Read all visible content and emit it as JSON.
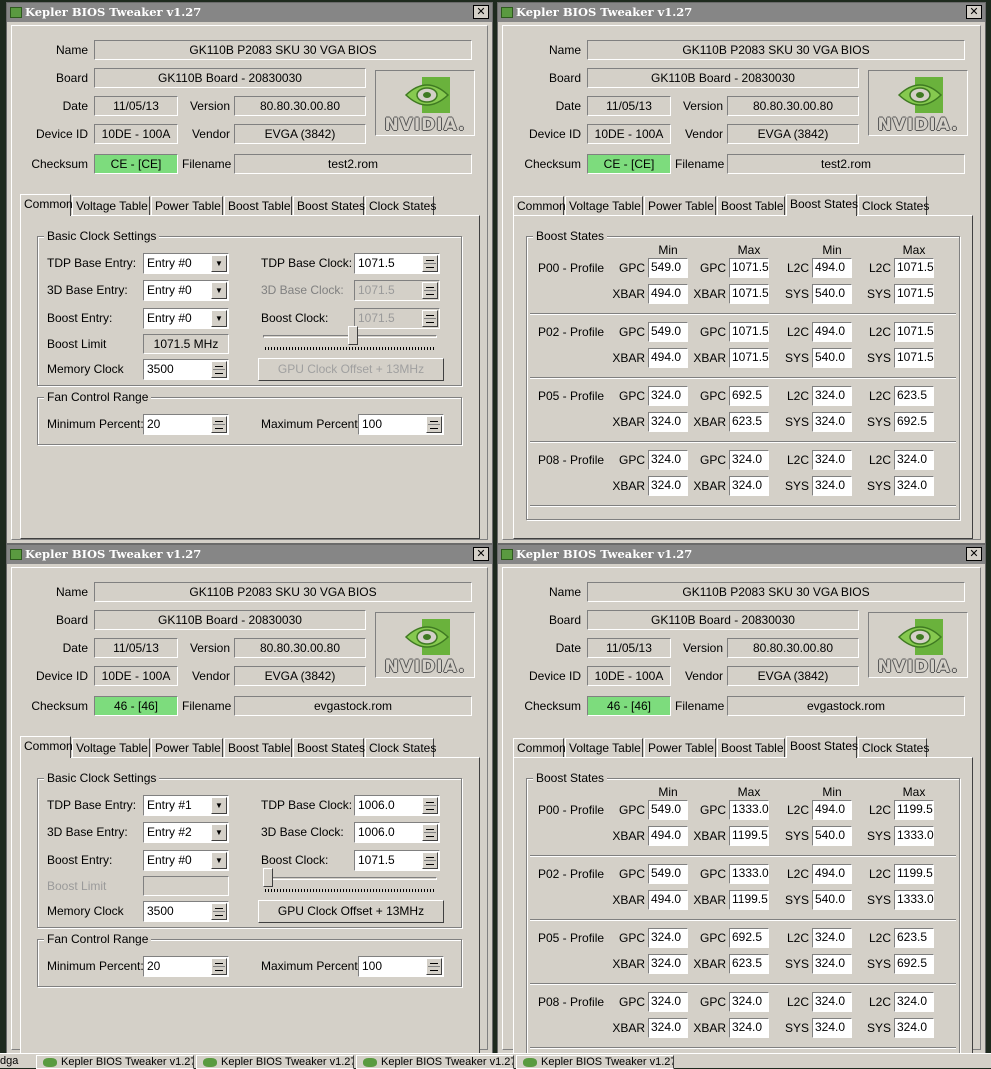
{
  "app": {
    "title": "Kepler BIOS Tweaker v1.27",
    "close_glyph": "✕",
    "logo_text": "NVIDIA."
  },
  "labels": {
    "name": "Name",
    "board": "Board",
    "date": "Date",
    "version": "Version",
    "device_id": "Device ID",
    "vendor": "Vendor",
    "checksum": "Checksum",
    "filename": "Filename"
  },
  "tabs": [
    "Common",
    "Voltage Table",
    "Power Table",
    "Boost Table",
    "Boost States",
    "Clock States"
  ],
  "common_labels": {
    "basic_clock_settings": "Basic Clock Settings",
    "tdp_base_entry": "TDP Base Entry:",
    "base3d_entry": "3D Base Entry:",
    "boost_entry": "Boost Entry:",
    "boost_limit": "Boost Limit",
    "memory_clock": "Memory Clock",
    "tdp_base_clock": "TDP Base Clock:",
    "base3d_clock": "3D Base Clock:",
    "boost_clock": "Boost Clock:",
    "gpu_offset_button": "GPU Clock Offset + 13MHz",
    "fan_control_range": "Fan Control Range",
    "min_percent": "Minimum Percent:",
    "max_percent": "Maximum Percent:"
  },
  "boost_labels": {
    "group": "Boost States",
    "min": "Min",
    "max": "Max",
    "gpc": "GPC",
    "xbar": "XBAR",
    "l2c": "L2C",
    "sys": "SYS"
  },
  "windows": {
    "tl": {
      "name": "GK110B P2083 SKU 30 VGA BIOS",
      "board": "GK110B Board - 20830030",
      "date": "11/05/13",
      "version": "80.80.30.00.80",
      "device_id": "10DE - 100A",
      "vendor": "EVGA (3842)",
      "checksum": "CE - [CE]",
      "filename": "test2.rom",
      "tdp_base_entry": "Entry #0",
      "base3d_entry": "Entry #0",
      "boost_entry": "Entry #0",
      "tdp_base_clock": "1071.5",
      "base3d_clock": "1071.5",
      "boost_clock": "1071.5",
      "boost_limit": "1071.5 MHz",
      "memory_clock": "3500",
      "min_percent": "20",
      "max_percent": "100"
    },
    "tr": {
      "name": "GK110B P2083 SKU 30 VGA BIOS",
      "board": "GK110B Board - 20830030",
      "date": "11/05/13",
      "version": "80.80.30.00.80",
      "device_id": "10DE - 100A",
      "vendor": "EVGA (3842)",
      "checksum": "CE - [CE]",
      "filename": "test2.rom",
      "profiles": [
        {
          "name": "P00 - Profile",
          "gpc_min": "549.0",
          "gpc_max": "1071.5",
          "l2c_min": "494.0",
          "l2c_max": "1071.5",
          "xbar_min": "494.0",
          "xbar_max": "1071.5",
          "sys_min": "540.0",
          "sys_max": "1071.5"
        },
        {
          "name": "P02 - Profile",
          "gpc_min": "549.0",
          "gpc_max": "1071.5",
          "l2c_min": "494.0",
          "l2c_max": "1071.5",
          "xbar_min": "494.0",
          "xbar_max": "1071.5",
          "sys_min": "540.0",
          "sys_max": "1071.5"
        },
        {
          "name": "P05 - Profile",
          "gpc_min": "324.0",
          "gpc_max": "692.5",
          "l2c_min": "324.0",
          "l2c_max": "623.5",
          "xbar_min": "324.0",
          "xbar_max": "623.5",
          "sys_min": "324.0",
          "sys_max": "692.5"
        },
        {
          "name": "P08 - Profile",
          "gpc_min": "324.0",
          "gpc_max": "324.0",
          "l2c_min": "324.0",
          "l2c_max": "324.0",
          "xbar_min": "324.0",
          "xbar_max": "324.0",
          "sys_min": "324.0",
          "sys_max": "324.0"
        }
      ]
    },
    "bl": {
      "name": "GK110B P2083 SKU 30 VGA BIOS",
      "board": "GK110B Board - 20830030",
      "date": "11/05/13",
      "version": "80.80.30.00.80",
      "device_id": "10DE - 100A",
      "vendor": "EVGA (3842)",
      "checksum": "46 - [46]",
      "filename": "evgastock.rom",
      "tdp_base_entry": "Entry #1",
      "base3d_entry": "Entry #2",
      "boost_entry": "Entry #0",
      "tdp_base_clock": "1006.0",
      "base3d_clock": "1006.0",
      "boost_clock": "1071.5",
      "boost_limit": "",
      "memory_clock": "3500",
      "min_percent": "20",
      "max_percent": "100"
    },
    "br": {
      "name": "GK110B P2083 SKU 30 VGA BIOS",
      "board": "GK110B Board - 20830030",
      "date": "11/05/13",
      "version": "80.80.30.00.80",
      "device_id": "10DE - 100A",
      "vendor": "EVGA (3842)",
      "checksum": "46 - [46]",
      "filename": "evgastock.rom",
      "profiles": [
        {
          "name": "P00 - Profile",
          "gpc_min": "549.0",
          "gpc_max": "1333.0",
          "l2c_min": "494.0",
          "l2c_max": "1199.5",
          "xbar_min": "494.0",
          "xbar_max": "1199.5",
          "sys_min": "540.0",
          "sys_max": "1333.0"
        },
        {
          "name": "P02 - Profile",
          "gpc_min": "549.0",
          "gpc_max": "1333.0",
          "l2c_min": "494.0",
          "l2c_max": "1199.5",
          "xbar_min": "494.0",
          "xbar_max": "1199.5",
          "sys_min": "540.0",
          "sys_max": "1333.0"
        },
        {
          "name": "P05 - Profile",
          "gpc_min": "324.0",
          "gpc_max": "692.5",
          "l2c_min": "324.0",
          "l2c_max": "623.5",
          "xbar_min": "324.0",
          "xbar_max": "623.5",
          "sys_min": "324.0",
          "sys_max": "692.5"
        },
        {
          "name": "P08 - Profile",
          "gpc_min": "324.0",
          "gpc_max": "324.0",
          "l2c_min": "324.0",
          "l2c_max": "324.0",
          "xbar_min": "324.0",
          "xbar_max": "324.0",
          "sys_min": "324.0",
          "sys_max": "324.0"
        }
      ]
    }
  },
  "taskbar": {
    "start_fragment": "dga",
    "items": [
      "Kepler BIOS Tweaker v1.27",
      "Kepler BIOS Tweaker v1.27",
      "Kepler BIOS Tweaker v1.27",
      "Kepler BIOS Tweaker v1.27"
    ]
  }
}
